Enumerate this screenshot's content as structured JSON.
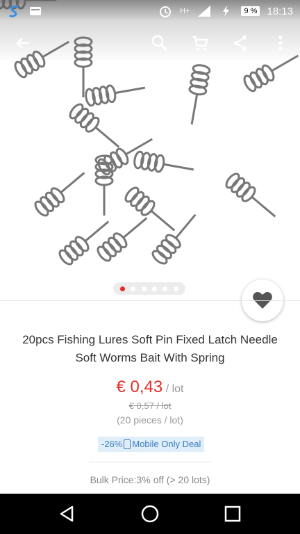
{
  "status_bar": {
    "time": "18:13",
    "battery": "9 %",
    "network": "H+",
    "left_icons": [
      "s-app-icon",
      "storage-icon"
    ],
    "right_icons": [
      "alarm-icon",
      "network-icon",
      "signal-icon",
      "charging-icon"
    ]
  },
  "app_bar": {
    "icons": [
      "back-arrow-icon",
      "search-icon",
      "cart-icon",
      "share-icon",
      "more-vert-icon"
    ]
  },
  "gallery": {
    "pages": 6,
    "active_page": 1
  },
  "product": {
    "title": "20pcs Fishing Lures Soft Pin Fixed Latch Needle Soft Worms Bait With Spring",
    "price": "€ 0,43",
    "price_unit": "/ lot",
    "original_price": "€ 0,57 / lot",
    "pieces": "(20 pieces / lot)",
    "discount": "-26%",
    "deal_label": "Mobile Only Deal",
    "bulk_price": "Bulk Price:3% off (> 20 lots)"
  },
  "colors": {
    "accent": "#e52d27",
    "deal_bg": "#dfeef9",
    "deal_text": "#3b7bbf"
  },
  "nav_bar": {
    "icons": [
      "back-triangle-icon",
      "home-icon",
      "recents-icon"
    ]
  }
}
